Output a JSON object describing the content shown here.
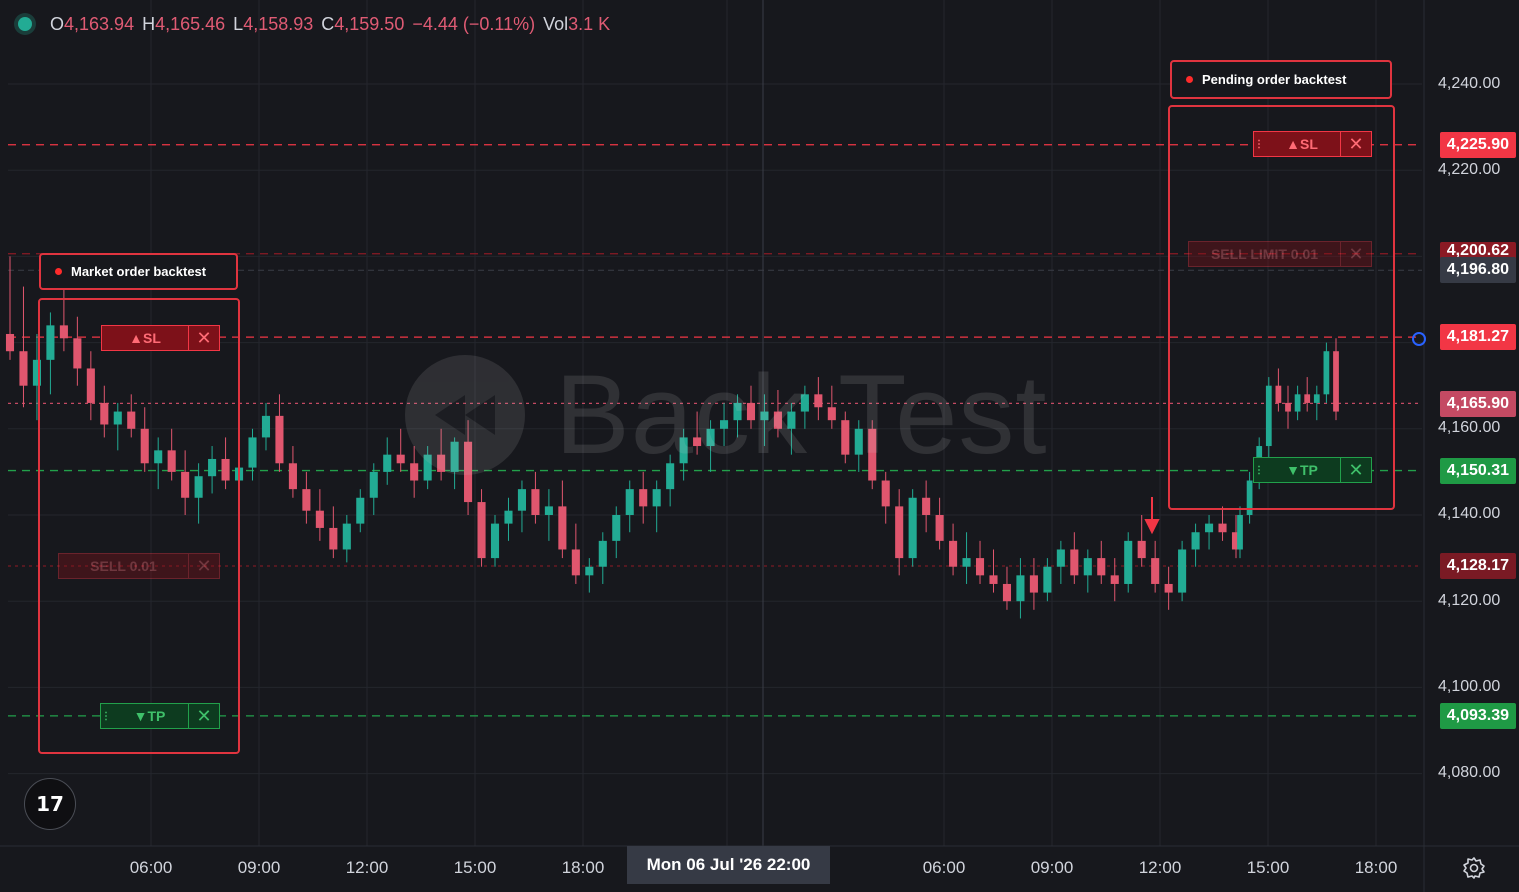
{
  "ohlc": {
    "open_label": "O",
    "open_value": "4,163.94",
    "high_label": "H",
    "high_value": "4,165.46",
    "low_label": "L",
    "low_value": "4,158.93",
    "close_label": "C",
    "close_value": "4,159.50",
    "change": "−4.44 (−0.11%)",
    "vol_label": "Vol",
    "vol_value": "3.1 K"
  },
  "watermark": {
    "text": "Back Test"
  },
  "annotations": {
    "market": "Market order backtest",
    "pending": "Pending order backtest"
  },
  "market_order": {
    "sl_label": "▲SL",
    "entry_label": "SELL 0.01",
    "tp_label": "▼TP",
    "close_icon": "✕"
  },
  "pending_order": {
    "sl_label": "▲SL",
    "entry_label": "SELL LIMIT 0.01",
    "tp_label": "▼TP",
    "close_icon": "✕"
  },
  "price_labels": {
    "pending_sl": "4,225.90",
    "pending_entry": "4,200.62",
    "crosshair": "4,196.80",
    "market_sl": "4,181.27",
    "last": "4,165.90",
    "pending_tp": "4,150.31",
    "market_entry": "4,128.17",
    "market_tp": "4,093.39"
  },
  "price_axis": [
    "4,240.00",
    "4,220.00",
    "4,160.00",
    "4,140.00",
    "4,120.00",
    "4,100.00",
    "4,080.00"
  ],
  "time_axis": [
    "06:00",
    "09:00",
    "12:00",
    "15:00",
    "18:00",
    "06:00",
    "09:00",
    "12:00",
    "15:00",
    "18:00"
  ],
  "crosshair_time": "Mon 06 Jul '26   22:00",
  "logo_text": "17",
  "colors": {
    "up": "#22ab94",
    "down": "#e0566e",
    "sl": "#f23645",
    "tp": "#22a04b",
    "background": "#17181d",
    "grid": "#24262d"
  },
  "icons": {
    "logo": "tradingview-logo-icon",
    "settings": "gear-icon",
    "close": "close-icon",
    "grip": "drag-handle-icon"
  },
  "chart_data": {
    "type": "candlestick",
    "y_range": [
      4069,
      4248
    ],
    "price_ticks": [
      4240,
      4220,
      4160,
      4140,
      4120,
      4100,
      4080
    ],
    "price_levels": [
      {
        "name": "pending_sl",
        "value": 4225.9,
        "style": "dashed",
        "color": "#f23645"
      },
      {
        "name": "pending_entry",
        "value": 4200.62,
        "style": "dashed",
        "color": "#8b1a24"
      },
      {
        "name": "market_sl",
        "value": 4181.27,
        "style": "dashed",
        "color": "#f23645"
      },
      {
        "name": "last",
        "value": 4165.9,
        "style": "dotted",
        "color": "#c44a63"
      },
      {
        "name": "pending_tp",
        "value": 4150.31,
        "style": "dashed",
        "color": "#22a04b"
      },
      {
        "name": "market_entry",
        "value": 4128.17,
        "style": "dotted",
        "color": "#7a1a24"
      },
      {
        "name": "market_tp",
        "value": 4093.39,
        "style": "dashed",
        "color": "#22a04b"
      }
    ],
    "segments": [
      {
        "start": 4196,
        "candles": [
          [
            4182,
            4200,
            4176,
            4178
          ],
          [
            4178,
            4193,
            4165,
            4170
          ],
          [
            4170,
            4182,
            4162,
            4176
          ],
          [
            4176,
            4187,
            4168,
            4184
          ],
          [
            4184,
            4195,
            4178,
            4181
          ],
          [
            4181,
            4186,
            4170,
            4174
          ],
          [
            4174,
            4178,
            4162,
            4166
          ],
          [
            4166,
            4170,
            4158,
            4161
          ],
          [
            4161,
            4166,
            4155,
            4164
          ],
          [
            4164,
            4168,
            4158,
            4160
          ],
          [
            4160,
            4165,
            4150,
            4152
          ],
          [
            4152,
            4158,
            4146,
            4155
          ],
          [
            4155,
            4160,
            4148,
            4150
          ],
          [
            4150,
            4155,
            4140,
            4144
          ],
          [
            4144,
            4152,
            4138,
            4149
          ],
          [
            4149,
            4156,
            4145,
            4153
          ],
          [
            4153,
            4158,
            4146,
            4148
          ],
          [
            4148,
            4154,
            4142,
            4151
          ],
          [
            4151,
            4160,
            4148,
            4158
          ],
          [
            4158,
            4166,
            4155,
            4163
          ],
          [
            4163,
            4168,
            4150,
            4152
          ],
          [
            4152,
            4156,
            4144,
            4146
          ],
          [
            4146,
            4150,
            4138,
            4141
          ],
          [
            4141,
            4146,
            4134,
            4137
          ],
          [
            4137,
            4142,
            4130,
            4132
          ],
          [
            4132,
            4140,
            4129,
            4138
          ],
          [
            4138,
            4146,
            4136,
            4144
          ],
          [
            4144,
            4152,
            4140,
            4150
          ],
          [
            4150,
            4158,
            4147,
            4154
          ],
          [
            4154,
            4160,
            4150,
            4152
          ],
          [
            4152,
            4156,
            4144,
            4148
          ],
          [
            4148,
            4156,
            4146,
            4154
          ],
          [
            4154,
            4160,
            4148,
            4150
          ],
          [
            4150,
            4158,
            4146,
            4157
          ],
          [
            4157,
            4162,
            4140,
            4143
          ],
          [
            4143,
            4146,
            4128,
            4130
          ],
          [
            4130,
            4140,
            4128,
            4138
          ],
          [
            4138,
            4144,
            4134,
            4141
          ],
          [
            4141,
            4148,
            4136,
            4146
          ],
          [
            4146,
            4150,
            4138,
            4140
          ],
          [
            4140,
            4146,
            4134,
            4142
          ],
          [
            4142,
            4148,
            4130,
            4132
          ],
          [
            4132,
            4138,
            4124,
            4126
          ],
          [
            4126,
            4130,
            4122,
            4128
          ],
          [
            4128,
            4136,
            4124,
            4134
          ],
          [
            4134,
            4142,
            4130,
            4140
          ],
          [
            4140,
            4148,
            4136,
            4146
          ],
          [
            4146,
            4150,
            4138,
            4142
          ],
          [
            4142,
            4148,
            4136,
            4146
          ],
          [
            4146,
            4154,
            4142,
            4152
          ],
          [
            4152,
            4160,
            4148,
            4158
          ],
          [
            4158,
            4164,
            4154,
            4156
          ],
          [
            4156,
            4162,
            4150,
            4160
          ],
          [
            4160,
            4166,
            4156,
            4162
          ],
          [
            4162,
            4168,
            4158,
            4166
          ],
          [
            4166,
            4170,
            4160,
            4162
          ],
          [
            4162,
            4168,
            4156,
            4164
          ],
          [
            4164,
            4169,
            4158,
            4160
          ],
          [
            4160,
            4166,
            4154,
            4164
          ],
          [
            4164,
            4170,
            4160,
            4168
          ],
          [
            4168,
            4172,
            4162,
            4165
          ],
          [
            4165,
            4170,
            4160,
            4162
          ],
          [
            4162,
            4164,
            4152,
            4154
          ],
          [
            4154,
            4162,
            4150,
            4160
          ],
          [
            4160,
            4162,
            4146,
            4148
          ],
          [
            4148,
            4150,
            4138,
            4142
          ],
          [
            4142,
            4146,
            4126,
            4130
          ],
          [
            4130,
            4146,
            4128,
            4144
          ],
          [
            4144,
            4148,
            4136,
            4140
          ],
          [
            4140,
            4144,
            4132,
            4134
          ],
          [
            4134,
            4138,
            4126,
            4128
          ],
          [
            4128,
            4136,
            4124,
            4130
          ],
          [
            4130,
            4134,
            4124,
            4126
          ],
          [
            4126,
            4132,
            4122,
            4124
          ],
          [
            4124,
            4128,
            4118,
            4120
          ],
          [
            4120,
            4130,
            4116,
            4126
          ],
          [
            4126,
            4130,
            4118,
            4122
          ],
          [
            4122,
            4130,
            4120,
            4128
          ],
          [
            4128,
            4134,
            4124,
            4132
          ],
          [
            4132,
            4136,
            4124,
            4126
          ],
          [
            4126,
            4132,
            4122,
            4130
          ],
          [
            4130,
            4134,
            4124,
            4126
          ],
          [
            4126,
            4130,
            4120,
            4124
          ],
          [
            4124,
            4136,
            4122,
            4134
          ],
          [
            4134,
            4140,
            4128,
            4130
          ],
          [
            4130,
            4134,
            4122,
            4124
          ],
          [
            4124,
            4128,
            4118,
            4122
          ],
          [
            4122,
            4134,
            4120,
            4132
          ],
          [
            4132,
            4138,
            4128,
            4136
          ],
          [
            4136,
            4140,
            4132,
            4138
          ],
          [
            4138,
            4142,
            4134,
            4136
          ],
          [
            4136,
            4140,
            4130,
            4132
          ]
        ]
      },
      {
        "start": 4132,
        "candles": [
          [
            4132,
            4142,
            4130,
            4140
          ],
          [
            4140,
            4150,
            4138,
            4148
          ],
          [
            4148,
            4158,
            4146,
            4156
          ],
          [
            4156,
            4172,
            4152,
            4170
          ],
          [
            4170,
            4174,
            4164,
            4166
          ],
          [
            4166,
            4170,
            4160,
            4164
          ],
          [
            4164,
            4170,
            4162,
            4168
          ],
          [
            4168,
            4172,
            4164,
            4166
          ],
          [
            4166,
            4170,
            4162,
            4168
          ],
          [
            4168,
            4180,
            4166,
            4178
          ],
          [
            4178,
            4181,
            4162,
            4164
          ]
        ]
      }
    ]
  }
}
